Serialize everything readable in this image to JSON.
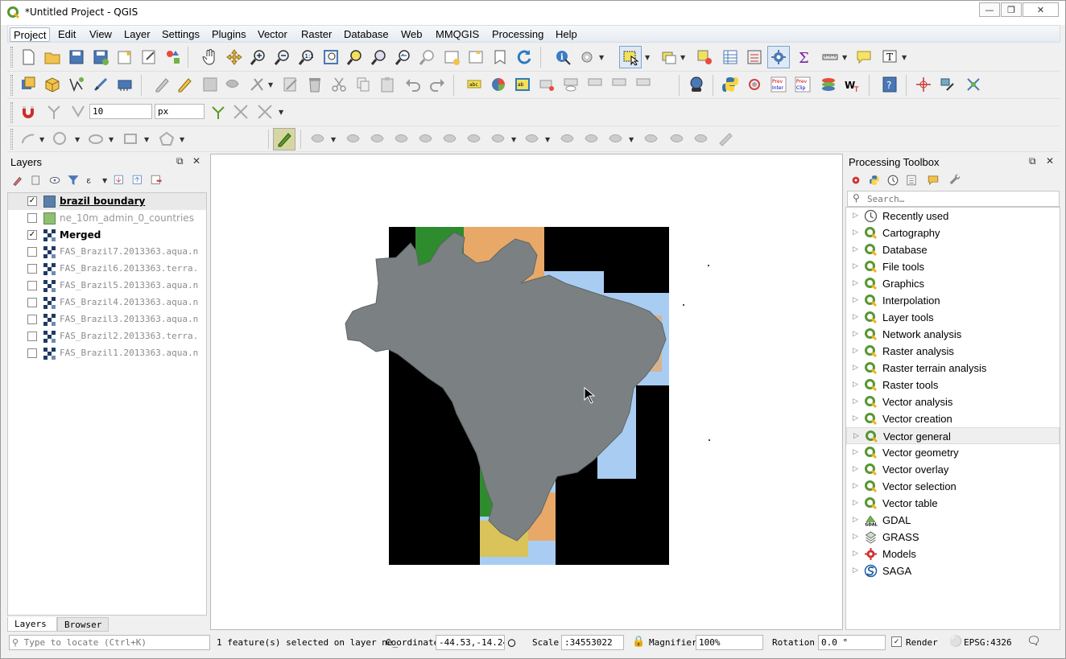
{
  "window": {
    "title": "*Untitled Project - QGIS"
  },
  "menu": [
    "Project",
    "Edit",
    "View",
    "Layer",
    "Settings",
    "Plugins",
    "Vector",
    "Raster",
    "Database",
    "Web",
    "MMQGIS",
    "Processing",
    "Help"
  ],
  "digitize": {
    "value": "10",
    "unit": "px"
  },
  "layers_panel": {
    "title": "Layers",
    "items": [
      {
        "name": "brazil boundary",
        "checked": true,
        "symbol": "fill-blue",
        "style": "bold-underline"
      },
      {
        "name": "ne_10m_admin_0_countries",
        "checked": false,
        "symbol": "fill-green",
        "style": "off"
      },
      {
        "name": "Merged",
        "checked": true,
        "symbol": "raster",
        "style": "bold"
      },
      {
        "name": "FAS_Brazil7.2013363.aqua.n",
        "checked": false,
        "symbol": "raster",
        "style": "off"
      },
      {
        "name": "FAS_Brazil6.2013363.terra.",
        "checked": false,
        "symbol": "raster",
        "style": "off"
      },
      {
        "name": "FAS_Brazil5.2013363.aqua.n",
        "checked": false,
        "symbol": "raster",
        "style": "off"
      },
      {
        "name": "FAS_Brazil4.2013363.aqua.n",
        "checked": false,
        "symbol": "raster",
        "style": "off"
      },
      {
        "name": "FAS_Brazil3.2013363.aqua.n",
        "checked": false,
        "symbol": "raster",
        "style": "off"
      },
      {
        "name": "FAS_Brazil2.2013363.terra.",
        "checked": false,
        "symbol": "raster",
        "style": "off"
      },
      {
        "name": "FAS_Brazil1.2013363.aqua.n",
        "checked": false,
        "symbol": "raster",
        "style": "off"
      }
    ],
    "tabs": [
      "Layers",
      "Browser"
    ]
  },
  "toolbox": {
    "title": "Processing Toolbox",
    "search_placeholder": "Search…",
    "items": [
      {
        "label": "Recently used",
        "icon": "clock-icon"
      },
      {
        "label": "Cartography",
        "icon": "qgis-icon"
      },
      {
        "label": "Database",
        "icon": "qgis-icon"
      },
      {
        "label": "File tools",
        "icon": "qgis-icon"
      },
      {
        "label": "Graphics",
        "icon": "qgis-icon"
      },
      {
        "label": "Interpolation",
        "icon": "qgis-icon"
      },
      {
        "label": "Layer tools",
        "icon": "qgis-icon"
      },
      {
        "label": "Network analysis",
        "icon": "qgis-icon"
      },
      {
        "label": "Raster analysis",
        "icon": "qgis-icon"
      },
      {
        "label": "Raster terrain analysis",
        "icon": "qgis-icon"
      },
      {
        "label": "Raster tools",
        "icon": "qgis-icon"
      },
      {
        "label": "Vector analysis",
        "icon": "qgis-icon"
      },
      {
        "label": "Vector creation",
        "icon": "qgis-icon"
      },
      {
        "label": "Vector general",
        "icon": "qgis-icon"
      },
      {
        "label": "Vector geometry",
        "icon": "qgis-icon"
      },
      {
        "label": "Vector overlay",
        "icon": "qgis-icon"
      },
      {
        "label": "Vector selection",
        "icon": "qgis-icon"
      },
      {
        "label": "Vector table",
        "icon": "qgis-icon"
      },
      {
        "label": "GDAL",
        "icon": "gdal-icon"
      },
      {
        "label": "GRASS",
        "icon": "grass-icon"
      },
      {
        "label": "Models",
        "icon": "models-icon"
      },
      {
        "label": "SAGA",
        "icon": "saga-icon"
      }
    ]
  },
  "status": {
    "locate_placeholder": "Type to locate (Ctrl+K)",
    "message": "1 feature(s) selected on layer ne_",
    "coordinate_label": "Coordinate",
    "coordinate": "-44.53,-14.24",
    "scale_label": "Scale",
    "scale": ":34553022",
    "magnifier_label": "Magnifier",
    "magnifier": "100%",
    "rotation_label": "Rotation",
    "rotation": "0.0 °",
    "render_label": "Render",
    "crs": "EPSG:4326"
  },
  "colors": {
    "boundary_fill": "#7b8183",
    "raster_black": "#000000",
    "water": "#a9cdf2",
    "vegetation": "#2e8b2e",
    "arid": "#e8a868"
  }
}
